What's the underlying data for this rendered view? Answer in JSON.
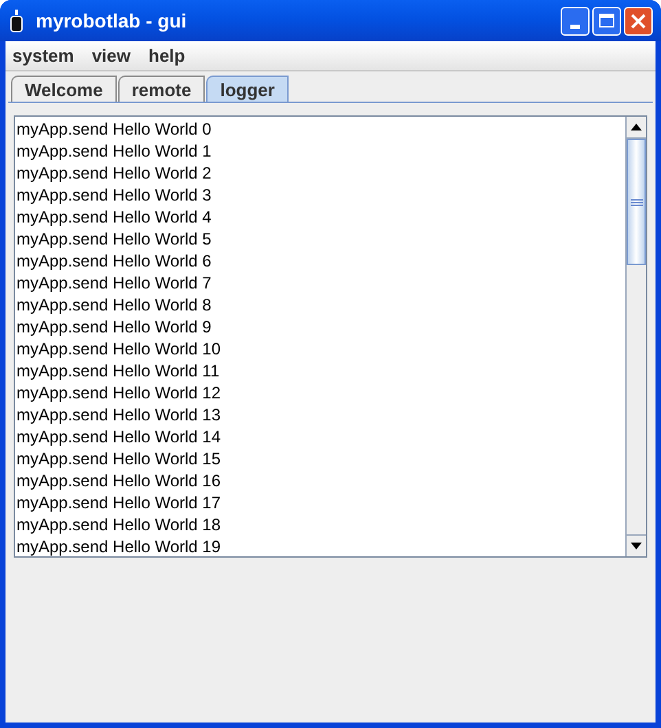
{
  "window": {
    "title": "myrobotlab - gui"
  },
  "menu": [
    "system",
    "view",
    "help"
  ],
  "tabs": [
    {
      "label": "Welcome",
      "selected": false
    },
    {
      "label": "remote",
      "selected": false
    },
    {
      "label": "logger",
      "selected": true
    }
  ],
  "log_lines": [
    "myApp.send Hello World 0",
    "myApp.send Hello World 1",
    "myApp.send Hello World 2",
    "myApp.send Hello World 3",
    "myApp.send Hello World 4",
    "myApp.send Hello World 5",
    "myApp.send Hello World 6",
    "myApp.send Hello World 7",
    "myApp.send Hello World 8",
    "myApp.send Hello World 9",
    "myApp.send Hello World 10",
    "myApp.send Hello World 11",
    "myApp.send Hello World 12",
    "myApp.send Hello World 13",
    "myApp.send Hello World 14",
    "myApp.send Hello World 15",
    "myApp.send Hello World 16",
    "myApp.send Hello World 17",
    "myApp.send Hello World 18",
    "myApp.send Hello World 19"
  ]
}
